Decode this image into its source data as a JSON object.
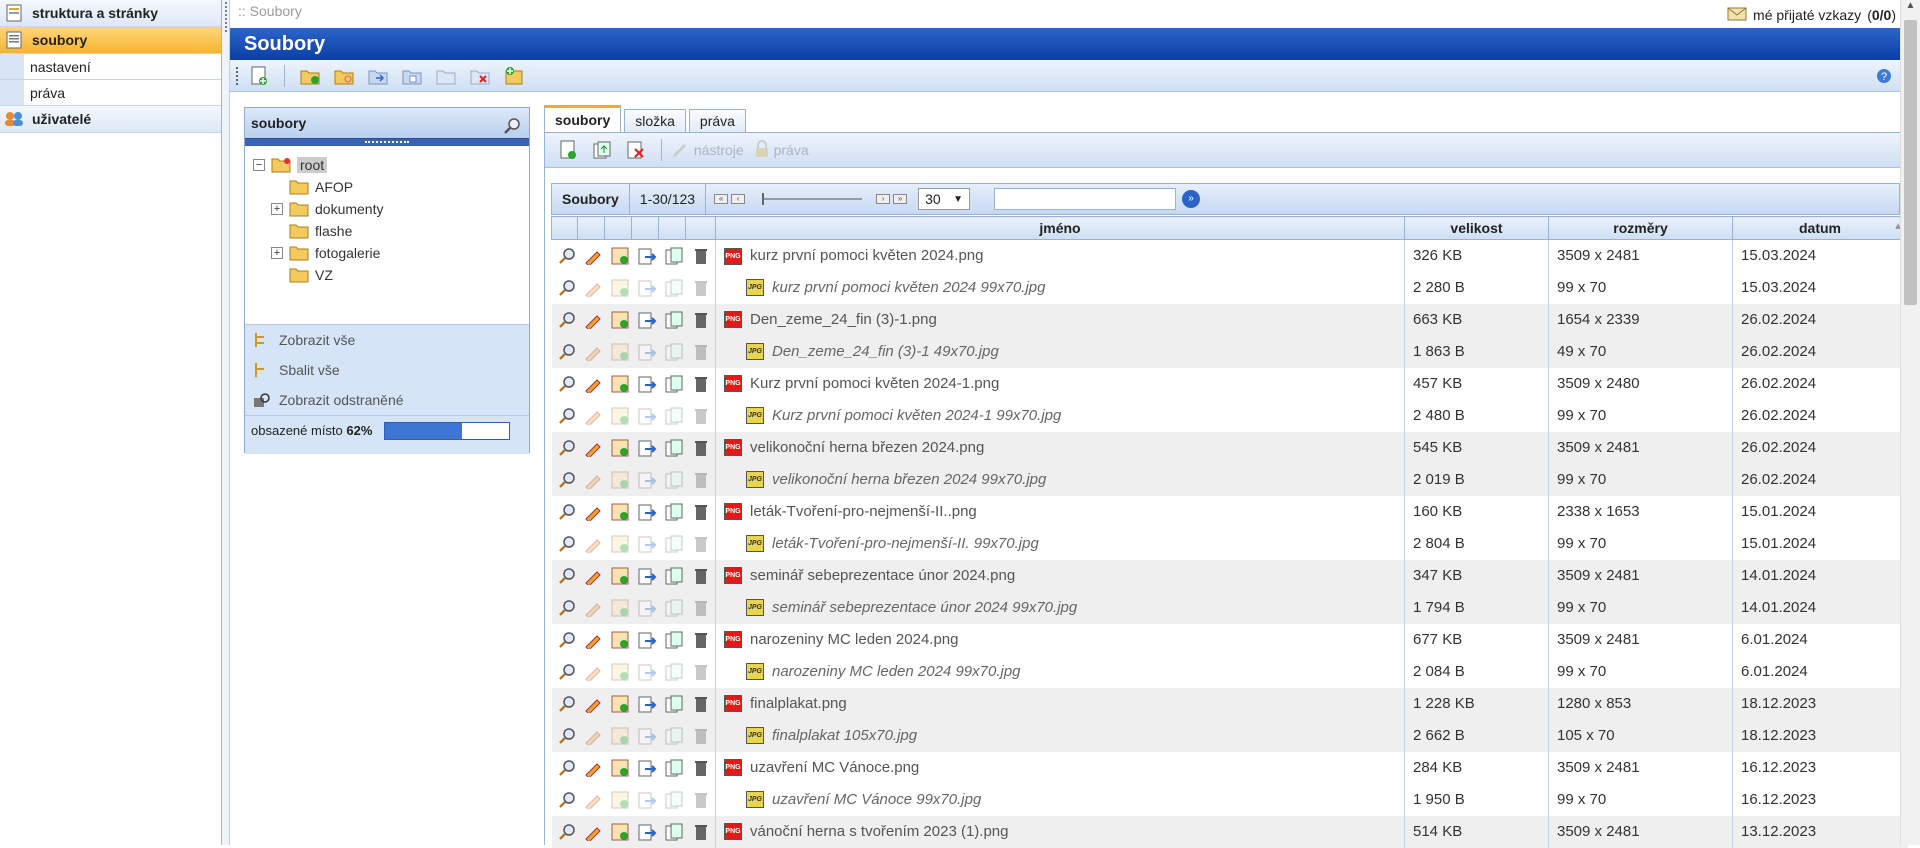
{
  "left_nav": {
    "items": [
      {
        "label": "struktura a stránky",
        "icon": "pages-icon",
        "active": false
      },
      {
        "label": "soubory",
        "icon": "files-icon",
        "active": true
      },
      {
        "label": "uživatelé",
        "icon": "users-icon",
        "active": false
      }
    ],
    "sub_items": [
      "nastavení",
      "práva"
    ]
  },
  "breadcrumb": ":: Soubory",
  "messages": {
    "label": "mé přijaté vzkazy",
    "count": "0/0"
  },
  "page_title": "Soubory",
  "tree": {
    "title": "soubory",
    "root": "root",
    "folders": [
      {
        "name": "AFOP",
        "expandable": false
      },
      {
        "name": "dokumenty",
        "expandable": true
      },
      {
        "name": "flashe",
        "expandable": false
      },
      {
        "name": "fotogalerie",
        "expandable": true
      },
      {
        "name": "VZ",
        "expandable": false
      }
    ],
    "show_all": "Zobrazit vše",
    "collapse_all": "Sbalit vše",
    "show_deleted": "Zobrazit odstraněné",
    "used_label": "obsazené místo",
    "used_value": "62%",
    "used_fraction": 0.62
  },
  "tabs": [
    "soubory",
    "složka",
    "práva"
  ],
  "right_toolbar": {
    "tools_label": "nástroje",
    "rights_label": "práva"
  },
  "pager": {
    "title": "Soubory",
    "range": "1-30/123",
    "per_page": "30"
  },
  "columns": [
    "jméno",
    "velikost",
    "rozměry",
    "datum"
  ],
  "rows": [
    {
      "name": "kurz první pomoci květen 2024.png",
      "size": "326 KB",
      "dims": "3509 x 2481",
      "date": "15.03.2024",
      "type": "png"
    },
    {
      "name": "kurz první pomoci květen 2024 99x70.jpg",
      "size": "2 280 B",
      "dims": "99 x 70",
      "date": "15.03.2024",
      "type": "jpg"
    },
    {
      "name": "Den_zeme_24_fin (3)-1.png",
      "size": "663 KB",
      "dims": "1654 x 2339",
      "date": "26.02.2024",
      "type": "png"
    },
    {
      "name": "Den_zeme_24_fin (3)-1 49x70.jpg",
      "size": "1 863 B",
      "dims": "49 x 70",
      "date": "26.02.2024",
      "type": "jpg"
    },
    {
      "name": "Kurz první pomoci květen 2024-1.png",
      "size": "457 KB",
      "dims": "3509 x 2480",
      "date": "26.02.2024",
      "type": "png"
    },
    {
      "name": "Kurz první pomoci květen 2024-1 99x70.jpg",
      "size": "2 480 B",
      "dims": "99 x 70",
      "date": "26.02.2024",
      "type": "jpg"
    },
    {
      "name": "velikonoční herna březen 2024.png",
      "size": "545 KB",
      "dims": "3509 x 2481",
      "date": "26.02.2024",
      "type": "png"
    },
    {
      "name": "velikonoční herna březen 2024 99x70.jpg",
      "size": "2 019 B",
      "dims": "99 x 70",
      "date": "26.02.2024",
      "type": "jpg"
    },
    {
      "name": "leták-Tvoření-pro-nejmenší-II..png",
      "size": "160 KB",
      "dims": "2338 x 1653",
      "date": "15.01.2024",
      "type": "png"
    },
    {
      "name": "leták-Tvoření-pro-nejmenší-II. 99x70.jpg",
      "size": "2 804 B",
      "dims": "99 x 70",
      "date": "15.01.2024",
      "type": "jpg"
    },
    {
      "name": "seminář sebeprezentace únor 2024.png",
      "size": "347 KB",
      "dims": "3509 x 2481",
      "date": "14.01.2024",
      "type": "png"
    },
    {
      "name": "seminář sebeprezentace únor 2024 99x70.jpg",
      "size": "1 794 B",
      "dims": "99 x 70",
      "date": "14.01.2024",
      "type": "jpg"
    },
    {
      "name": "narozeniny MC leden 2024.png",
      "size": "677 KB",
      "dims": "3509 x 2481",
      "date": "6.01.2024",
      "type": "png"
    },
    {
      "name": "narozeniny MC leden 2024 99x70.jpg",
      "size": "2 084 B",
      "dims": "99 x 70",
      "date": "6.01.2024",
      "type": "jpg"
    },
    {
      "name": "finalplakat.png",
      "size": "1 228 KB",
      "dims": "1280 x 853",
      "date": "18.12.2023",
      "type": "png"
    },
    {
      "name": "finalplakat 105x70.jpg",
      "size": "2 662 B",
      "dims": "105 x 70",
      "date": "18.12.2023",
      "type": "jpg"
    },
    {
      "name": "uzavření MC Vánoce.png",
      "size": "284 KB",
      "dims": "3509 x 2481",
      "date": "16.12.2023",
      "type": "png"
    },
    {
      "name": "uzavření MC Vánoce 99x70.jpg",
      "size": "1 950 B",
      "dims": "99 x 70",
      "date": "16.12.2023",
      "type": "jpg"
    },
    {
      "name": "vánoční herna s tvořením 2023 (1).png",
      "size": "514 KB",
      "dims": "3509 x 2481",
      "date": "13.12.2023",
      "type": "png"
    }
  ],
  "file_badges": {
    "png": "PNG",
    "jpg": "JPG"
  }
}
